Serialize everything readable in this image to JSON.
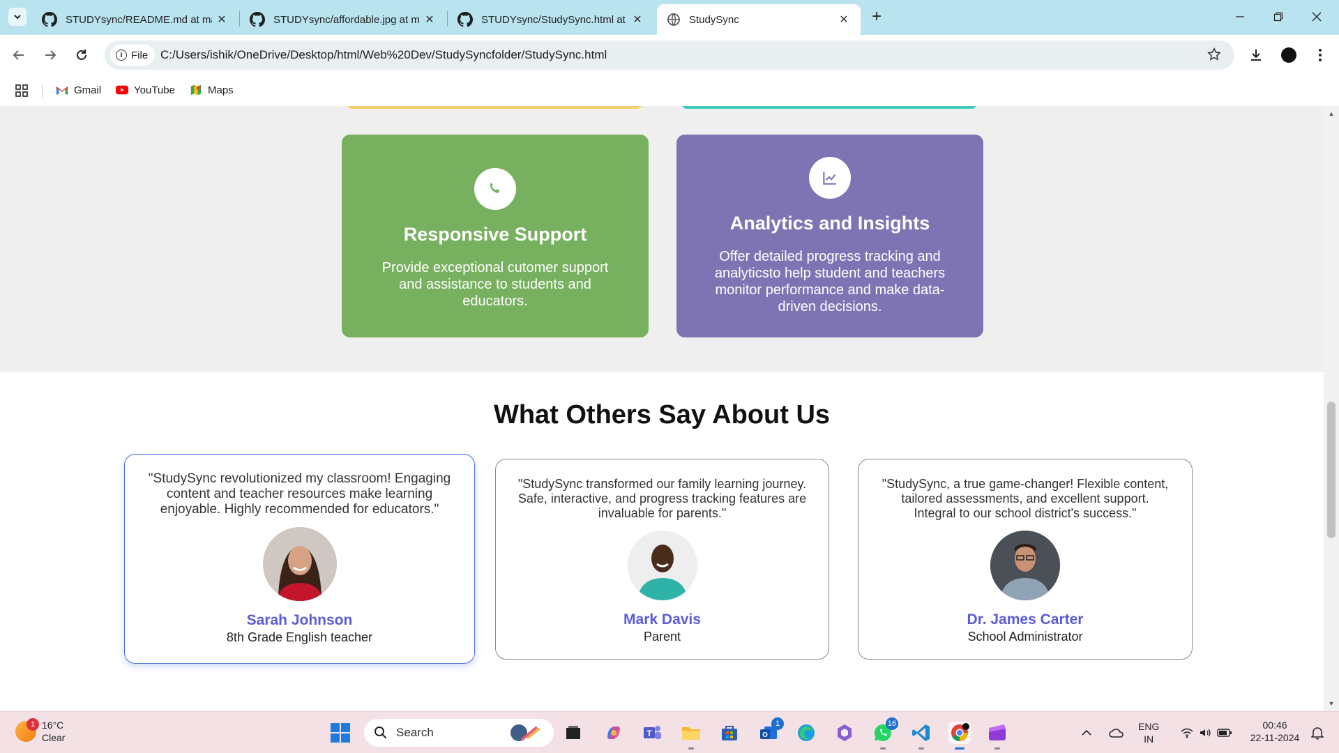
{
  "browser": {
    "tabs": [
      {
        "title": "STUDYsync/README.md at mai",
        "icon": "github-icon",
        "active": false
      },
      {
        "title": "STUDYsync/affordable.jpg at ma",
        "icon": "github-icon",
        "active": false
      },
      {
        "title": "STUDYsync/StudySync.html at m",
        "icon": "github-icon",
        "active": false
      },
      {
        "title": "StudySync",
        "icon": "globe-icon",
        "active": true
      }
    ],
    "file_chip": "File",
    "url": "C:/Users/ishik/OneDrive/Desktop/html/Web%20Dev/StudySyncfolder/StudySync.html",
    "bookmarks": [
      {
        "label": "Gmail",
        "icon": "gmail-icon"
      },
      {
        "label": "YouTube",
        "icon": "youtube-icon"
      },
      {
        "label": "Maps",
        "icon": "maps-icon"
      }
    ]
  },
  "features": [
    {
      "title": "Responsive Support",
      "description": "Provide exceptional cutomer support and assistance to students and educators.",
      "icon": "phone-icon",
      "color": "#77b05e"
    },
    {
      "title": "Analytics and Insights",
      "description": "Offer detailed progress tracking and analyticsto help student and teachers monitor performance and make data-driven decisions.",
      "icon": "chart-line-icon",
      "color": "#7f74b3"
    }
  ],
  "testimonials": {
    "heading": "What Others Say About Us",
    "items": [
      {
        "quote": "\"StudySync revolutionized my classroom! Engaging content and teacher resources make learning enjoyable. Highly recommended for educators.\"",
        "name": "Sarah Johnson",
        "role": "8th Grade English teacher"
      },
      {
        "quote": "\"StudySync transformed our family learning journey. Safe, interactive, and progress tracking features are invaluable for parents.\"",
        "name": "Mark Davis",
        "role": "Parent"
      },
      {
        "quote": "\"StudySync, a true game-changer! Flexible content, tailored assessments, and excellent support. Integral to our school district's success.\"",
        "name": "Dr. James Carter",
        "role": "School Administrator"
      }
    ],
    "accent_color": "#5b5bd6"
  },
  "taskbar": {
    "weather_temp": "16°C",
    "weather_desc": "Clear",
    "weather_badge": "1",
    "search_placeholder": "Search",
    "store_badge": "1",
    "whatsapp_badge": "16",
    "language_line1": "ENG",
    "language_line2": "IN",
    "time": "00:46",
    "date": "22-11-2024"
  }
}
